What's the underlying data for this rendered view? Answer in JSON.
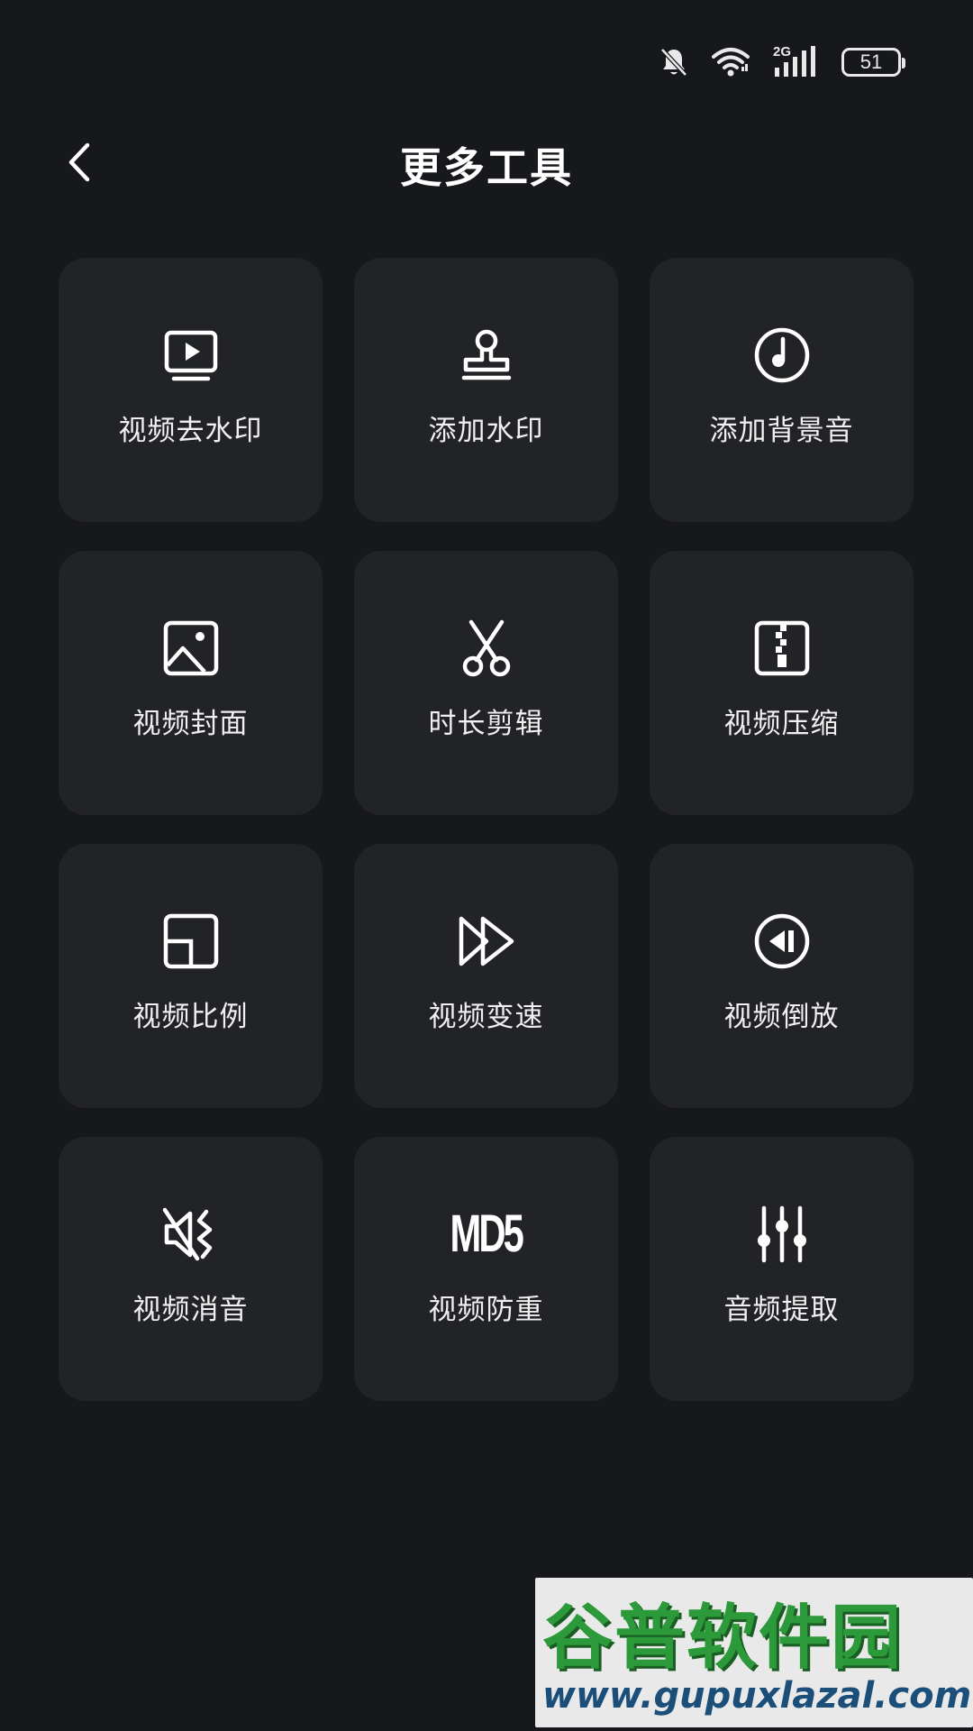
{
  "status_bar": {
    "network_label": "2G",
    "battery_level": "51",
    "icons": [
      "bell-muted-icon",
      "wifi-icon",
      "signal-icon",
      "battery-icon"
    ]
  },
  "header": {
    "title": "更多工具",
    "back_icon": "chevron-left-icon"
  },
  "tools": [
    {
      "label": "视频去水印",
      "icon": "monitor-play-icon"
    },
    {
      "label": "添加水印",
      "icon": "stamp-icon"
    },
    {
      "label": "添加背景音",
      "icon": "music-circle-icon"
    },
    {
      "label": "视频封面",
      "icon": "image-icon"
    },
    {
      "label": "时长剪辑",
      "icon": "scissors-icon"
    },
    {
      "label": "视频压缩",
      "icon": "zip-icon"
    },
    {
      "label": "视频比例",
      "icon": "aspect-ratio-icon"
    },
    {
      "label": "视频变速",
      "icon": "fast-forward-icon"
    },
    {
      "label": "视频倒放",
      "icon": "reverse-play-icon"
    },
    {
      "label": "视频消音",
      "icon": "mute-icon"
    },
    {
      "label": "视频防重",
      "icon": "md5-icon",
      "icon_text": "MD5"
    },
    {
      "label": "音频提取",
      "icon": "equalizer-icon"
    }
  ],
  "watermark": {
    "name": "谷普软件园",
    "url": "www.gupuxlazal.com"
  },
  "colors": {
    "background": "#17181c",
    "tile": "#222327",
    "text": "#ffffff",
    "watermark_green": "#2c9a3a"
  }
}
